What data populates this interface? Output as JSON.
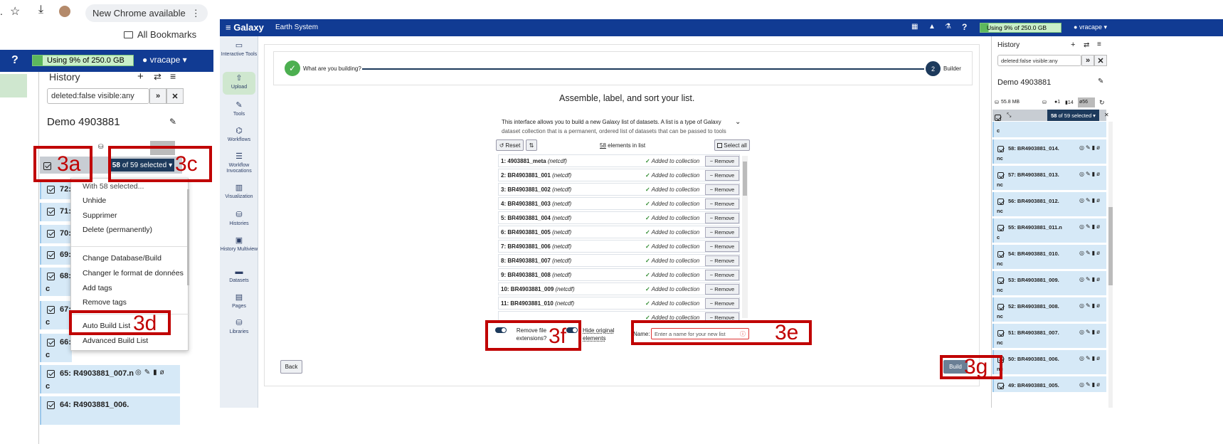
{
  "left": {
    "chrome": {
      "update_label": "New Chrome available",
      "bookmarks_label": "All Bookmarks"
    },
    "galaxy_bar": {
      "storage_label": "Using 9% of 250.0 GB",
      "user_label": "vracape"
    },
    "history": {
      "title": "History",
      "filter_value": "deleted:false visible:any",
      "name": "Demo 4903881",
      "selected_label": "of 59 selected",
      "selected_count": "58",
      "rows_short": [
        {
          "label": "72:"
        },
        {
          "label": "71:"
        },
        {
          "label": "70:"
        },
        {
          "label": "69:"
        },
        {
          "label": "68:",
          "ext": "c"
        },
        {
          "label": "67:",
          "ext": "c"
        },
        {
          "label": "66:",
          "ext": "c"
        }
      ],
      "row_65": {
        "label": "65: R4903881_007.n",
        "ext": "c"
      },
      "row_64": {
        "label": "64: R4903881_006."
      }
    },
    "dropdown": {
      "items": [
        "With 58 selected...",
        "Unhide",
        "Supprimer",
        "Delete (permanently)",
        "Change Database/Build",
        "Changer le format de données",
        "Add tags",
        "Remove tags",
        "Auto Build List",
        "Advanced Build List"
      ]
    },
    "annotations": {
      "a": "3a",
      "c": "3c",
      "d": "3d"
    }
  },
  "mid": {
    "galaxy_bar": {
      "brand": "Galaxy",
      "subtitle": "Earth System",
      "storage_label": "Using 9% of 250.0 GB",
      "user_label": "vracape"
    },
    "nav": [
      {
        "label": "Interactive Tools"
      },
      {
        "label": "Upload"
      },
      {
        "label": "Tools"
      },
      {
        "label": "Workflows"
      },
      {
        "label": "Workflow Invocations"
      },
      {
        "label": "Visualization"
      },
      {
        "label": "Histories"
      },
      {
        "label": "History Multiview"
      },
      {
        "label": "Datasets"
      },
      {
        "label": "Pages"
      },
      {
        "label": "Libraries"
      }
    ],
    "stepper": {
      "step1": "What are you building?",
      "step2_num": "2",
      "step2": "Builder"
    },
    "builder": {
      "heading": "Assemble, label, and sort your list.",
      "intro_line1": "This interface allows you to build a new Galaxy list of datasets. A list is a type of Galaxy",
      "intro_line2": "dataset collection that is a permanent, ordered list of datasets that can be passed to tools",
      "reset_label": "Reset",
      "count_num": "58",
      "count_text": "elements in list",
      "select_all_label": "Select all",
      "status_text": "Added to collection",
      "remove_label": "Remove",
      "elements": [
        {
          "name": "1: 4903881_meta",
          "ext": "(netcdf)"
        },
        {
          "name": "2: BR4903881_001",
          "ext": "(netcdf)"
        },
        {
          "name": "3: BR4903881_002",
          "ext": "(netcdf)"
        },
        {
          "name": "4: BR4903881_003",
          "ext": "(netcdf)"
        },
        {
          "name": "5: BR4903881_004",
          "ext": "(netcdf)"
        },
        {
          "name": "6: BR4903881_005",
          "ext": "(netcdf)"
        },
        {
          "name": "7: BR4903881_006",
          "ext": "(netcdf)"
        },
        {
          "name": "8: BR4903881_007",
          "ext": "(netcdf)"
        },
        {
          "name": "9: BR4903881_008",
          "ext": "(netcdf)"
        },
        {
          "name": "10: BR4903881_009",
          "ext": "(netcdf)"
        },
        {
          "name": "11: BR4903881_010",
          "ext": "(netcdf)"
        }
      ],
      "remove_ext_label": "Remove file extensions?",
      "hide_original_label": "Hide original elements",
      "name_label": "Name:",
      "name_placeholder": "Enter a name for your new list",
      "back_label": "Back",
      "build_label": "Build"
    },
    "right_history": {
      "title": "History",
      "filter_value": "deleted:false visible:any",
      "name": "Demo 4903881",
      "size": "55.8 MB",
      "stat_pin": "1",
      "stat_deleted": "14",
      "stat_hidden": "56",
      "selected_count": "58",
      "selected_label": "of 59 selected",
      "rows": [
        {
          "name": "58: BR4903881_014.",
          "ext": "nc"
        },
        {
          "name": "57: BR4903881_013.",
          "ext": "nc"
        },
        {
          "name": "56: BR4903881_012.",
          "ext": "nc"
        },
        {
          "name": "55: BR4903881_011.n",
          "ext": "c"
        },
        {
          "name": "54: BR4903881_010.",
          "ext": "nc"
        },
        {
          "name": "53: BR4903881_009.",
          "ext": "nc"
        },
        {
          "name": "52: BR4903881_008.",
          "ext": "nc"
        },
        {
          "name": "51: BR4903881_007.",
          "ext": "nc"
        },
        {
          "name": "50: BR4903881_006.",
          "ext": "nc"
        },
        {
          "name": "49: BR4903881_005.",
          "ext": "nc"
        }
      ]
    },
    "annotations": {
      "e": "3e",
      "f": "3f",
      "g": "3g"
    }
  },
  "colors": {
    "galaxy_blue": "#113b93",
    "annotation_red": "#c00000",
    "row_blue": "#d6e9f7",
    "stepper_dark": "#1d3a5c"
  }
}
